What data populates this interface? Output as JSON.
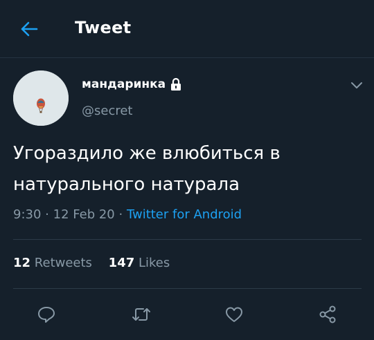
{
  "header": {
    "title": "Tweet",
    "back_icon": "arrow-left-icon",
    "accent_color": "#1da1f2"
  },
  "author": {
    "display_name": "мандаринка",
    "username": "@secret",
    "protected_icon": "lock-icon",
    "avatar": "hot-air-balloon",
    "menu_icon": "chevron-down-icon"
  },
  "tweet": {
    "text_line1": "Угораздило же влюбиться в",
    "text_line2": "натурального натурала",
    "time": "9:30",
    "separator": "·",
    "date": "12 Feb 20",
    "source": "Twitter for Android"
  },
  "stats": {
    "retweets_count": "12",
    "retweets_label": "Retweets",
    "likes_count": "147",
    "likes_label": "Likes"
  },
  "actions": [
    "reply-icon",
    "retweet-icon",
    "like-icon",
    "share-icon"
  ],
  "colors": {
    "background": "#15202b",
    "secondary_text": "#8899a6",
    "divider": "#2d3b48"
  }
}
